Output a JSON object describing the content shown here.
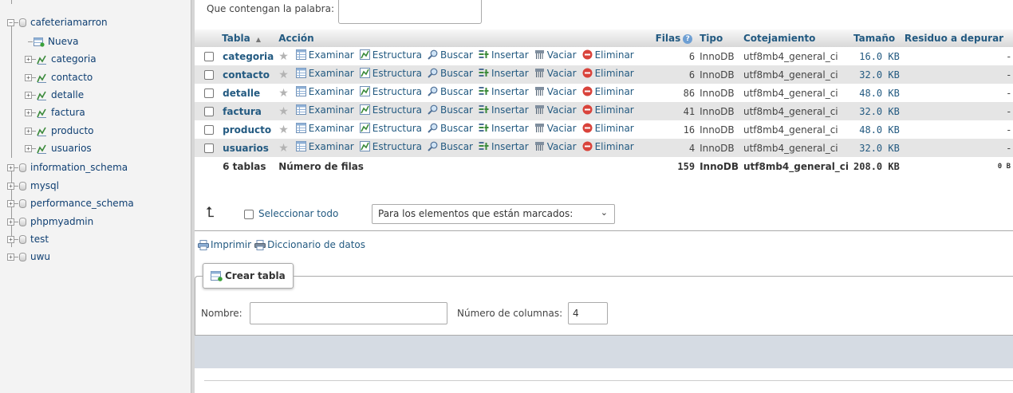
{
  "nav": {
    "current_db": "cafeteriamarron",
    "new_label": "Nueva",
    "tables": [
      "categoria",
      "contacto",
      "detalle",
      "factura",
      "producto",
      "usuarios"
    ],
    "other_dbs": [
      "information_schema",
      "mysql",
      "performance_schema",
      "phpmyadmin",
      "test",
      "uwu"
    ]
  },
  "filter": {
    "label": "Que contengan la palabra:",
    "value": ""
  },
  "table": {
    "headers": {
      "table": "Tabla",
      "sort_indicator": "▲",
      "action": "Acción",
      "rows": "Filas",
      "type": "Tipo",
      "collation": "Cotejamiento",
      "size": "Tamaño",
      "overhead": "Residuo a depurar"
    },
    "actions": {
      "browse": "Examinar",
      "structure": "Estructura",
      "search": "Buscar",
      "insert": "Insertar",
      "empty": "Vaciar",
      "drop": "Eliminar"
    },
    "rows": [
      {
        "name": "categoria",
        "rows": "6",
        "type": "InnoDB",
        "collation": "utf8mb4_general_ci",
        "size": "16.0 KB",
        "overhead": "-"
      },
      {
        "name": "contacto",
        "rows": "6",
        "type": "InnoDB",
        "collation": "utf8mb4_general_ci",
        "size": "32.0 KB",
        "overhead": "-"
      },
      {
        "name": "detalle",
        "rows": "86",
        "type": "InnoDB",
        "collation": "utf8mb4_general_ci",
        "size": "48.0 KB",
        "overhead": "-"
      },
      {
        "name": "factura",
        "rows": "41",
        "type": "InnoDB",
        "collation": "utf8mb4_general_ci",
        "size": "32.0 KB",
        "overhead": "-"
      },
      {
        "name": "producto",
        "rows": "16",
        "type": "InnoDB",
        "collation": "utf8mb4_general_ci",
        "size": "48.0 KB",
        "overhead": "-"
      },
      {
        "name": "usuarios",
        "rows": "4",
        "type": "InnoDB",
        "collation": "utf8mb4_general_ci",
        "size": "32.0 KB",
        "overhead": "-"
      }
    ],
    "footer": {
      "count": "6 tablas",
      "label": "Número de filas",
      "rows": "159",
      "type": "InnoDB",
      "collation": "utf8mb4_general_ci",
      "size": "208.0 KB",
      "overhead": "0 B"
    }
  },
  "bulk": {
    "select_all": "Seleccionar todo",
    "with_selected": "Para los elementos que están marcados:"
  },
  "links": {
    "print": "Imprimir",
    "data_dictionary": "Diccionario de datos"
  },
  "create": {
    "title": "Crear tabla",
    "name_label": "Nombre:",
    "name_value": "",
    "columns_label": "Número de columnas:",
    "columns_value": "4"
  }
}
